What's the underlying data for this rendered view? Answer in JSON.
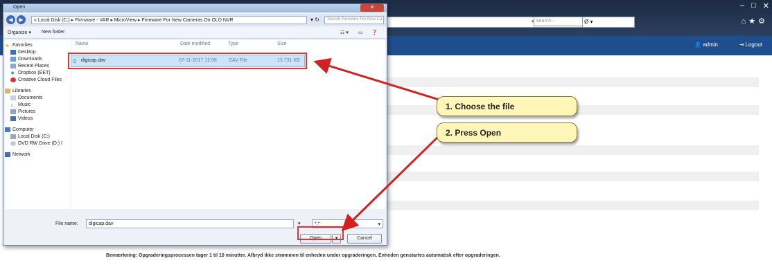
{
  "browser": {
    "address_text": "",
    "search_placeholder": "Search...",
    "addr_sep": "▾ C",
    "addr2_text": "Ø ▾"
  },
  "app": {
    "user": "admin",
    "logout": "Logout"
  },
  "note": "Bemærkning: Opgraderingsprocessen tager 1 til 10 minutter. Afbryd ikke strømmen til enheden under opgraderingen. Enheden genstartes automatisk efter opgraderingen.",
  "dialog": {
    "title": "Open",
    "breadcrumb": "« Local Disk (C:) ▸ Firmware - VAR ▸ MicroView ▸ Firmware For New Cameras On OLD NVR",
    "search_placeholder": "Search Firmware For New Ca...",
    "toolbar": {
      "organize": "Organize ▾",
      "new_folder": "New folder"
    },
    "columns": {
      "name": "Name",
      "date": "Date modified",
      "type": "Type",
      "size": "Size"
    },
    "sidebar": {
      "favorites": [
        "Favorites",
        "Desktop",
        "Downloads",
        "Recent Places",
        "Dropbox (EET)",
        "Creative Cloud Files"
      ],
      "libraries": [
        "Libraries",
        "Documents",
        "Music",
        "Pictures",
        "Videos"
      ],
      "computer": [
        "Computer",
        "Local Disk (C:)",
        "DVD RW Drive (D:) I"
      ],
      "network": [
        "Network"
      ]
    },
    "file": {
      "name": "digicap.dav",
      "date": "07-11-2017 12:08",
      "type": "DAV File",
      "size": "13.731 KB"
    },
    "filename_label": "File name:",
    "filename_value": "digicap.dav",
    "filetype_value": "*.*",
    "open": "Open",
    "cancel": "Cancel"
  },
  "callouts": {
    "step1": "1. Choose the file",
    "step2": "2. Press Open"
  }
}
